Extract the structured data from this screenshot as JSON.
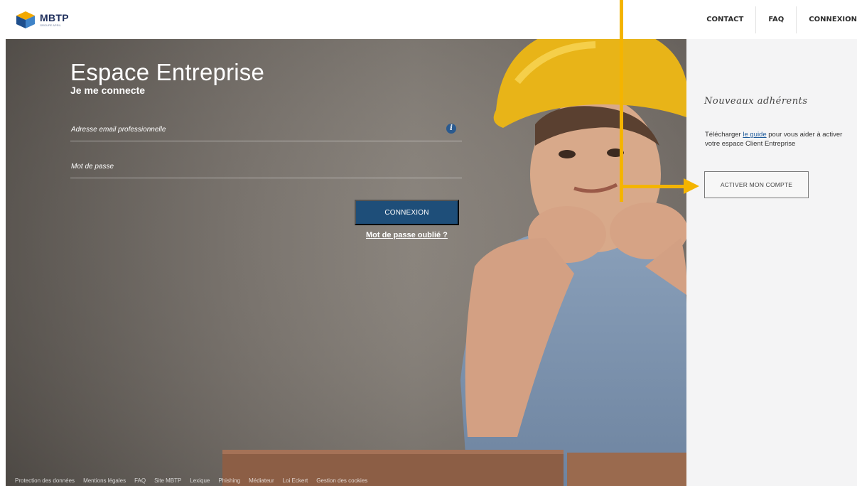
{
  "header": {
    "logo_name": "MBTP",
    "logo_sub": "GROUPE APRIL",
    "nav": [
      "CONTACT",
      "FAQ",
      "CONNEXION"
    ]
  },
  "login": {
    "title": "Espace Entreprise",
    "subtitle": "Je me connecte",
    "email_label": "Adresse email professionnelle",
    "password_label": "Mot de passe",
    "submit_label": "CONNEXION",
    "forgot_label": "Mot de passe oublié ?"
  },
  "panel": {
    "title": "Nouveaux adhérents",
    "text_before": "Télécharger ",
    "link_text": "le guide",
    "text_after": " pour vous aider à activer votre espace Client Entreprise",
    "activate_label": "ACTIVER MON COMPTE"
  },
  "footer": {
    "links": [
      "Protection des données",
      "Mentions légales",
      "FAQ",
      "Site MBTP",
      "Lexique",
      "Phishing",
      "Médiateur",
      "Loi Eckert",
      "Gestion des cookies"
    ]
  },
  "colors": {
    "primary_button": "#1e4e79",
    "annotation_arrow": "#f4b400",
    "logo_text": "#1f2f5c",
    "info_icon": "#2a5a8f"
  },
  "icons": {
    "logo": "cube-logo-icon",
    "info": "info-icon",
    "annotation": "arrow-right-icon"
  }
}
